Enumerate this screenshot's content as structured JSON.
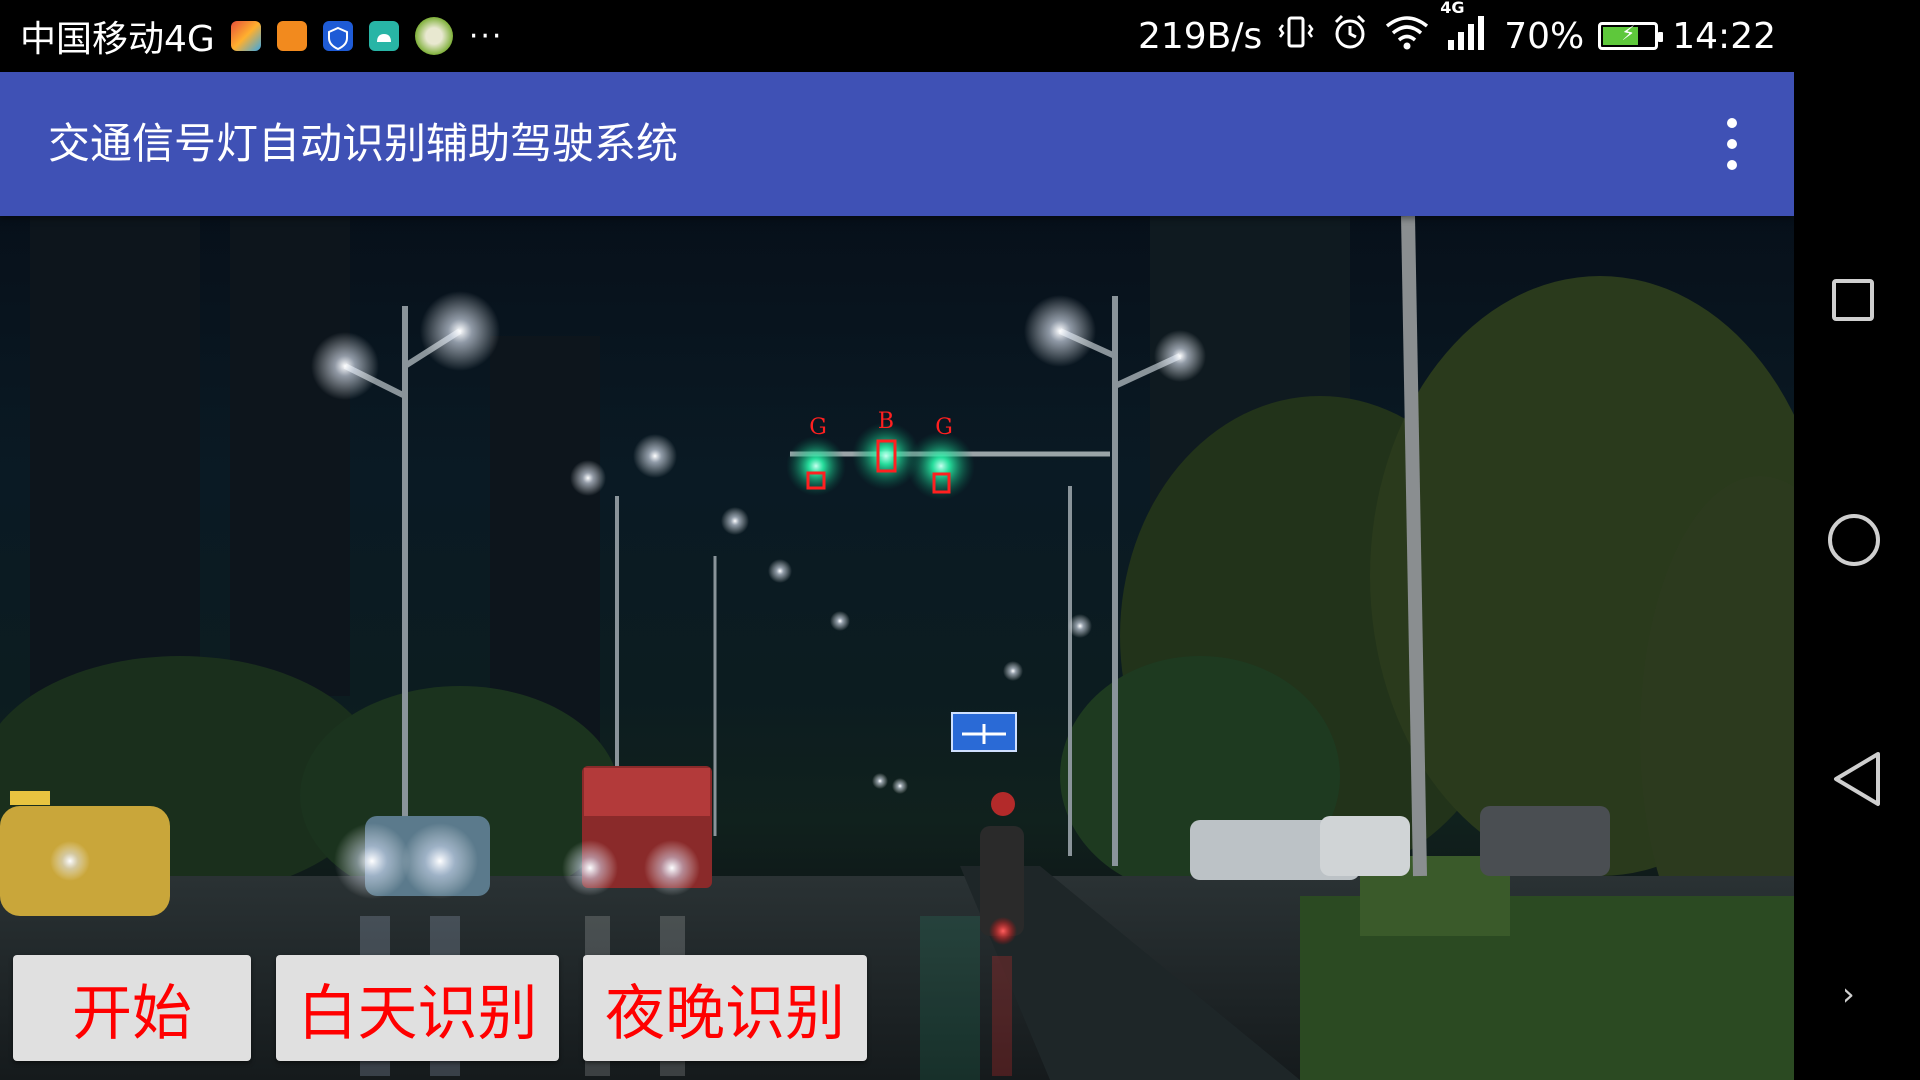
{
  "status_bar": {
    "carrier": "中国移动4G",
    "more": "···",
    "net_speed": "219B/s",
    "signal_type": "4G",
    "battery_percent": "70%",
    "battery_level": 0.7,
    "time": "14:22",
    "icons": [
      "app-icon-1",
      "app-icon-2",
      "shield-app-icon",
      "android-app-icon",
      "avatar-app-icon",
      "vibrate-icon",
      "alarm-icon",
      "wifi-icon",
      "cell-signal-icon",
      "battery-icon"
    ]
  },
  "app_bar": {
    "title": "交通信号灯自动识别辅助驾驶系统",
    "menu_icon": "overflow-menu-icon"
  },
  "detections": [
    {
      "label": "G",
      "color": "#ff2020"
    },
    {
      "label": "B",
      "color": "#ff2020"
    },
    {
      "label": "G",
      "color": "#ff2020"
    }
  ],
  "scene": {
    "sign_text": [
      "",
      ""
    ]
  },
  "buttons": {
    "start": "开始",
    "day": "白天识别",
    "night": "夜晚识别",
    "text_color": "#ff0000"
  },
  "nav": {
    "icons": [
      "recent-apps-icon",
      "home-icon",
      "back-icon",
      "expand-icon"
    ]
  },
  "colors": {
    "app_bar": "#3f51b5",
    "detection_box": "#ff2020",
    "green_light": "#2bffb0"
  }
}
